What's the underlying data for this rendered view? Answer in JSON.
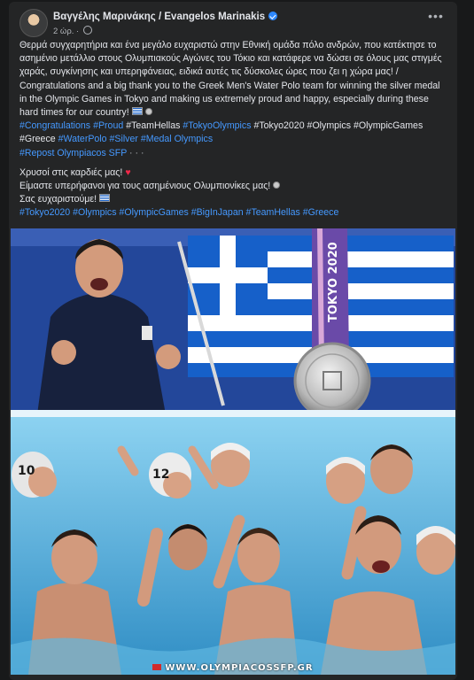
{
  "post": {
    "author": "Βαγγέλης Μαρινάκης / Evangelos Marinakis",
    "time": "2 ώρ.",
    "paragraph1": "Θερμά συγχαρητήρια και ένα μεγάλο ευχαριστώ στην Εθνική ομάδα πόλο ανδρών, που κατέκτησε το ασημένιο μετάλλιο στους Ολυμπιακούς Αγώνες του Τόκιο και κατάφερε να δώσει σε όλους μας στιγμές χαράς, συγκίνησης και υπερηφάνειας, ειδικά αυτές τις δύσκολες ώρες που ζει η χώρα μας! / Congratulations and a big thank you to the Greek Men's Water Polo team for winning the silver medal in the Olympic Games in Tokyo and making us extremely proud and happy, especially during these hard times for our country!",
    "hashtags1": [
      {
        "text": "#Congratulations",
        "link": true
      },
      {
        "text": "#Proud",
        "link": true
      },
      {
        "text": "#TeamHellas",
        "link": false
      },
      {
        "text": "#TokyoOlympics",
        "link": true
      },
      {
        "text": "#Tokyo2020",
        "link": false
      },
      {
        "text": "#Olympics",
        "link": false
      },
      {
        "text": "#OlympicGames",
        "link": false
      },
      {
        "text": "#Greece",
        "link": false
      },
      {
        "text": "#WaterPolo",
        "link": true
      },
      {
        "text": "#Silver",
        "link": true
      },
      {
        "text": "#Medal",
        "link": true
      },
      {
        "text": "Olympics",
        "link": true
      }
    ],
    "repost": "#Repost Olympiacos SFP",
    "repost_more": "· · ·",
    "line_gold": "Χρυσοί στις καρδιές μας!",
    "line_proud": "Είμαστε υπερήφανοι για τους ασημένιους Ολυμπιονίκες μας!",
    "line_thanks": "Σας ευχαριστούμε!",
    "hashtags2": "#Tokyo2020 #Olympics #OlympicGames #BigInJapan #TeamHellas #Greece"
  },
  "image": {
    "banner_text": "TOKYO 2020",
    "watermark": "WWW.OLYMPIACOSSFP.GR",
    "cap_numbers": [
      "10",
      "12"
    ]
  },
  "colors": {
    "link": "#4599ff",
    "background": "#18191a",
    "card": "#242526",
    "flag_blue": "#1660c9",
    "pool": "#6cc3ea"
  },
  "icons": [
    "verified-icon",
    "globe-icon",
    "more-options-icon",
    "greek-flag-emoji",
    "medal-emoji",
    "heart-emoji"
  ]
}
